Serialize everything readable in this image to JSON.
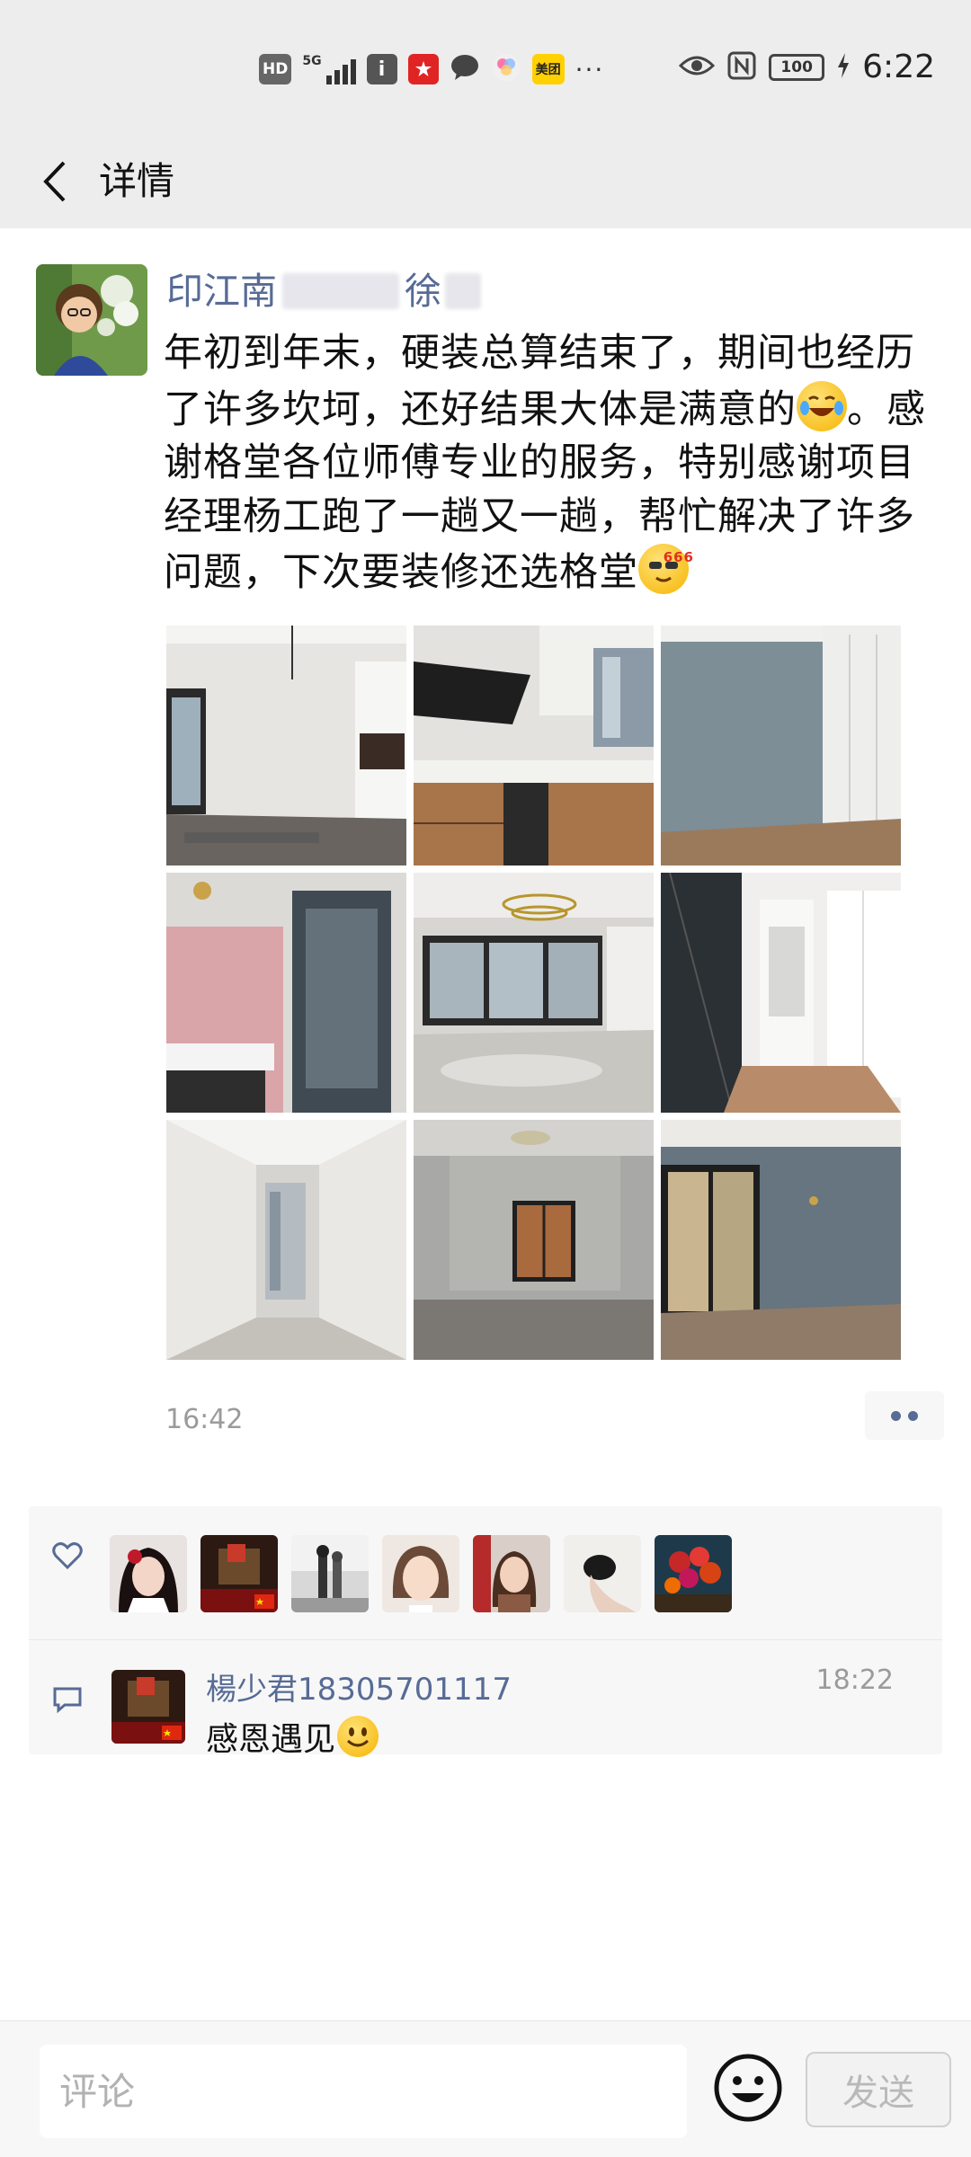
{
  "status_bar": {
    "hd": "HD",
    "network": "5G",
    "meituan": "美团",
    "battery": "100",
    "time": "6:22"
  },
  "header": {
    "title": "详情"
  },
  "post": {
    "author_part1": "印江南",
    "author_part2": "徐",
    "text_part1": "年初到年末，硬装总算结束了，期间也经历了许多坎坷，还好结果大体是满意的",
    "text_part2": "。感谢格堂各位师傅专业的服务，特别感谢项目经理杨工跑了一趟又一趟，帮忙解决了许多问题，下次要装修还选格堂",
    "emoji_1": "laughing-tears-emoji",
    "emoji_2": "cool-666-emoji",
    "badge_666": "666",
    "photos": [
      {
        "name": "living-room-window-photo"
      },
      {
        "name": "kitchen-photo"
      },
      {
        "name": "blue-wall-wardrobe-photo"
      },
      {
        "name": "bathroom-pink-wall-photo"
      },
      {
        "name": "living-room-chandelier-photo"
      },
      {
        "name": "walk-in-closet-photo"
      },
      {
        "name": "hallway-photo"
      },
      {
        "name": "empty-room-window-photo"
      },
      {
        "name": "blue-room-window-photo"
      }
    ],
    "time": "16:42"
  },
  "likes": {
    "count_avatars": 7
  },
  "comment": {
    "name": "楊少君18305701117",
    "time": "18:22",
    "text": "感恩遇见"
  },
  "bottom": {
    "placeholder": "评论",
    "send_label": "发送"
  },
  "colors": {
    "link": "#576b95",
    "header_bg": "#ededed",
    "panel_bg": "#f7f7f7"
  }
}
